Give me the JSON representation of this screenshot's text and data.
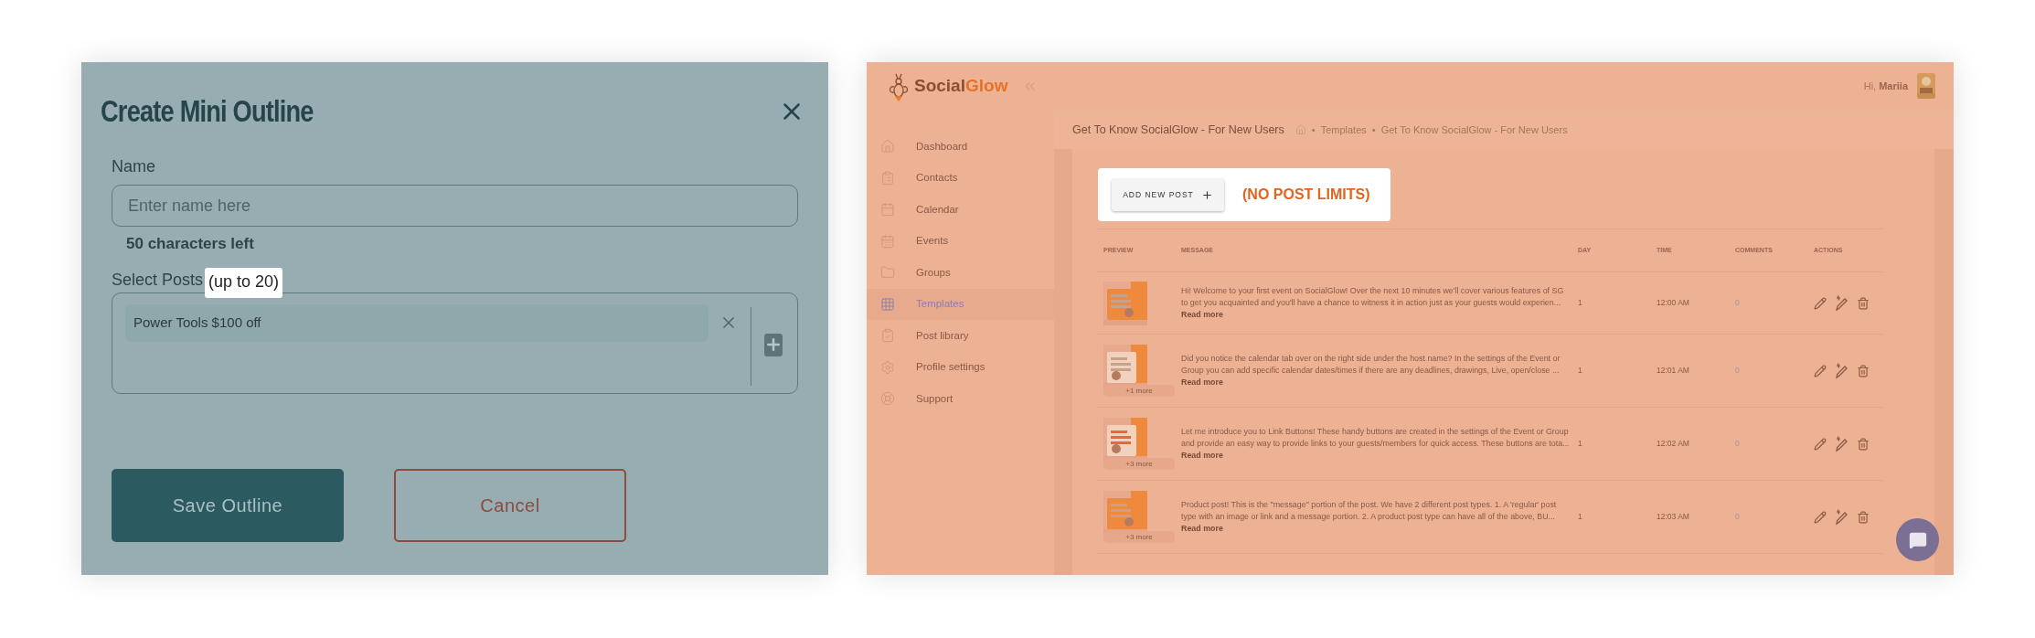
{
  "dialog": {
    "title": "Create Mini Outline",
    "name_label": "Name",
    "name_field": {
      "placeholder": "Enter name here"
    },
    "characters_left": "50 characters left",
    "posts_label": "Select Posts",
    "posts_limit": "(up to 20)",
    "selected_posts": [
      {
        "label": "Power Tools $100 off"
      }
    ],
    "buttons": [
      {
        "kind": "primary",
        "label": "Save Outline"
      },
      {
        "kind": "outline",
        "label": "Cancel"
      }
    ]
  },
  "app": {
    "logo": {
      "text_start": "Social",
      "text_end": "Glow"
    },
    "greeting": "Hi,",
    "user_name": "Mariia",
    "sidebar": {
      "items": [
        {
          "label": "Dashboard",
          "selected": false
        },
        {
          "label": "Contacts",
          "selected": false
        },
        {
          "label": "Calendar",
          "selected": false
        },
        {
          "label": "Events",
          "selected": false
        },
        {
          "label": "Groups",
          "selected": false
        },
        {
          "label": "Templates",
          "selected": true
        },
        {
          "label": "Post library",
          "selected": false
        },
        {
          "label": "Profile settings",
          "selected": false
        },
        {
          "label": "Support",
          "selected": false
        }
      ]
    },
    "page_title": "Get To Know SocialGlow - For New Users",
    "breadcrumb": [
      "•",
      "Templates",
      "•",
      "Get To Know SocialGlow - For New Users"
    ],
    "add_button": "ADD NEW POST",
    "limit_note": "(NO POST LIMITS)",
    "table": {
      "columns": [
        "PREVIEW",
        "MESSAGE",
        "DAY",
        "TIME",
        "COMMENTS",
        "ACTIONS"
      ],
      "rows": [
        {
          "more": null,
          "read_more": "Read more",
          "message": "Hi! Welcome to your first event on SocialGlow! Over the next 10 minutes we'll cover various features of SG to get you acquainted and you'll have a chance to witness it in action just as your guests would experien...",
          "day": "1",
          "time": "12:00 AM",
          "comments": "0"
        },
        {
          "more": "+1 more",
          "read_more": "Read more",
          "message": "Did you notice the calendar tab over on the right side under the host name? In the settings of the Event or Group you can add specific calendar dates/times if there are any deadlines, drawings, Live, open/close ...",
          "day": "1",
          "time": "12:01 AM",
          "comments": "0"
        },
        {
          "more": "+3 more",
          "read_more": "Read more",
          "message": "Let me introduce you to Link Buttons! These handy buttons are created in the settings of the Event or Group and provide an easy way to provide links to your guests/members for quick access. These buttons are tota...",
          "day": "1",
          "time": "12:02 AM",
          "comments": "0"
        },
        {
          "more": "+3 more",
          "read_more": "Read more",
          "message": "Product post! This is the \"message\" portion of the post. We have 2 different post types. 1. A 'regular' post type with an image or link and a message portion. 2. A product post type can have all of the above, BU...",
          "day": "1",
          "time": "12:03 AM",
          "comments": "0"
        }
      ]
    }
  }
}
